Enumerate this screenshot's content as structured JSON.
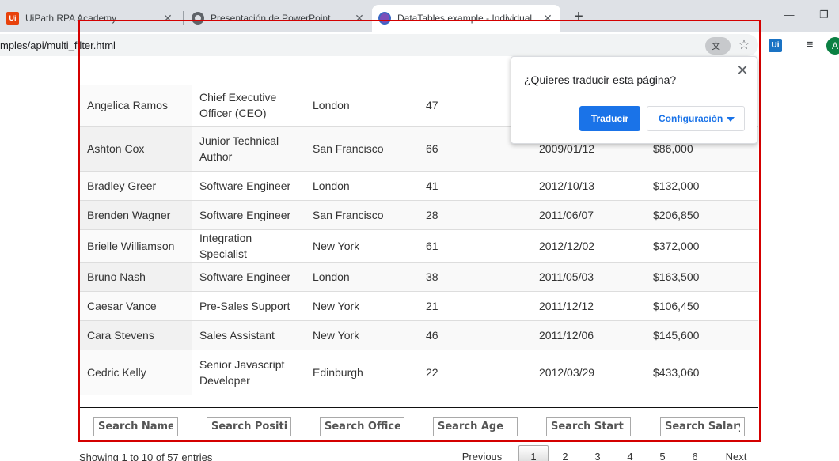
{
  "browser": {
    "tabs": [
      {
        "title": "UiPath RPA Academy",
        "favicon": "uipath-icon"
      },
      {
        "title": "Presentación de PowerPoint",
        "favicon": "globe-icon"
      },
      {
        "title": "DataTables example - Individual",
        "favicon": "datatables-icon"
      }
    ],
    "new_tab_symbol": "+",
    "url": "mples/api/multi_filter.html",
    "extension_label": "Ui",
    "profile_initial": "A",
    "window_controls": {
      "minimize": "—",
      "restore": "❐"
    }
  },
  "table": {
    "rows": [
      [
        "Angelica Ramos",
        "Chief Executive Officer (CEO)",
        "London",
        "47",
        "",
        ""
      ],
      [
        "Ashton Cox",
        "Junior Technical Author",
        "San Francisco",
        "66",
        "2009/01/12",
        "$86,000"
      ],
      [
        "Bradley Greer",
        "Software Engineer",
        "London",
        "41",
        "2012/10/13",
        "$132,000"
      ],
      [
        "Brenden Wagner",
        "Software Engineer",
        "San Francisco",
        "28",
        "2011/06/07",
        "$206,850"
      ],
      [
        "Brielle Williamson",
        "Integration Specialist",
        "New York",
        "61",
        "2012/12/02",
        "$372,000"
      ],
      [
        "Bruno Nash",
        "Software Engineer",
        "London",
        "38",
        "2011/05/03",
        "$163,500"
      ],
      [
        "Caesar Vance",
        "Pre-Sales Support",
        "New York",
        "21",
        "2011/12/12",
        "$106,450"
      ],
      [
        "Cara Stevens",
        "Sales Assistant",
        "New York",
        "46",
        "2011/12/06",
        "$145,600"
      ],
      [
        "Cedric Kelly",
        "Senior Javascript Developer",
        "Edinburgh",
        "22",
        "2012/03/29",
        "$433,060"
      ]
    ],
    "search_placeholders": [
      "Search Name",
      "Search Position",
      "Search Office",
      "Search Age",
      "Search Start date",
      "Search Salary"
    ]
  },
  "footer": {
    "info": "Showing 1 to 10 of 57 entries",
    "pagination": {
      "previous": "Previous",
      "pages": [
        "1",
        "2",
        "3",
        "4",
        "5",
        "6"
      ],
      "next": "Next",
      "current": "1"
    }
  },
  "translate_popup": {
    "title": "¿Quieres traducir esta página?",
    "translate_button": "Traducir",
    "settings_button": "Configuración",
    "close_symbol": "✕"
  }
}
